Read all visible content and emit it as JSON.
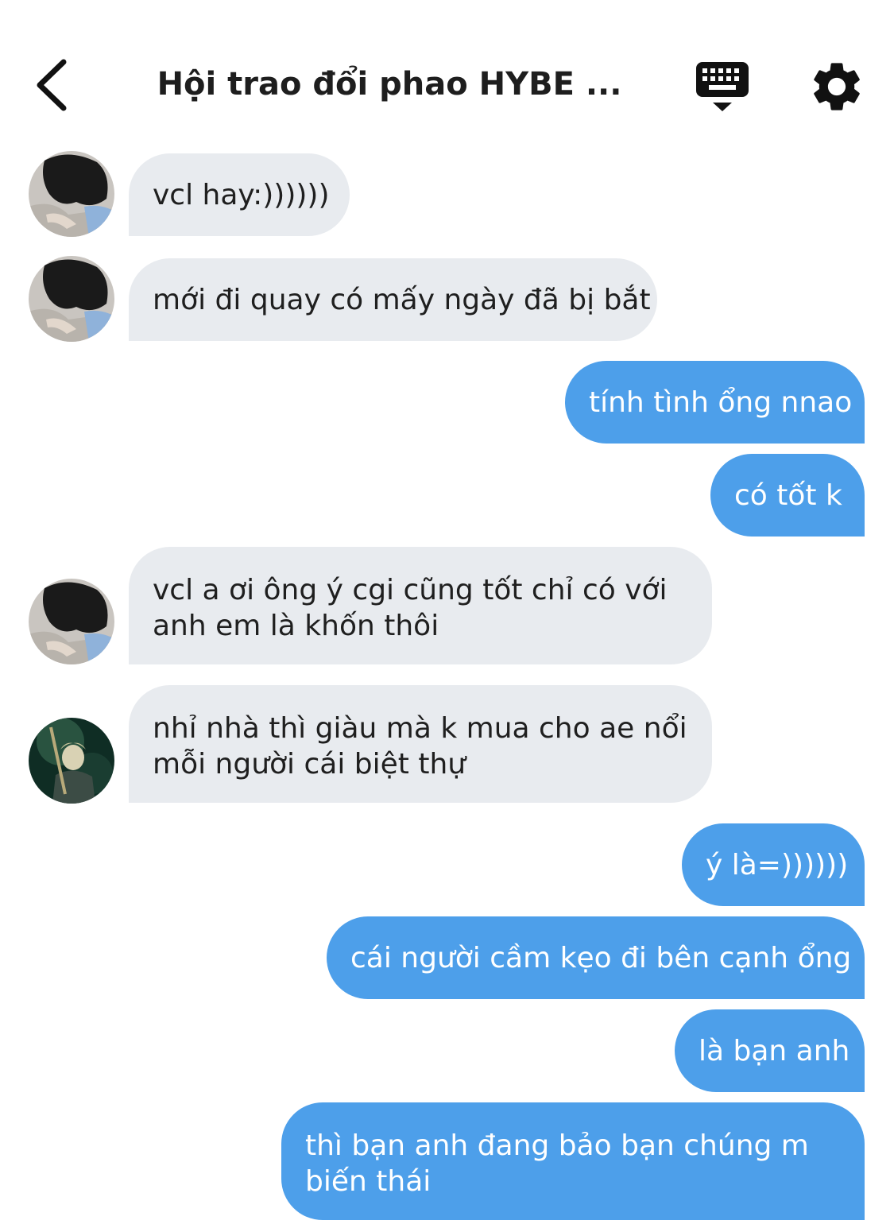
{
  "header": {
    "title": "Hội trao đổi phao HYBE ...",
    "back_icon": "chevron-left-icon",
    "keyboard_icon": "keyboard-icon",
    "settings_icon": "gear-icon"
  },
  "colors": {
    "incoming_bubble": "#e8ebef",
    "outgoing_bubble": "#4d9fea",
    "outgoing_text": "#ffffff",
    "incoming_text": "#1f1f1f"
  },
  "messages": [
    {
      "direction": "incoming",
      "sender_avatar": "avatar-a",
      "lines": [
        "vcl hay:))))))"
      ]
    },
    {
      "direction": "incoming",
      "sender_avatar": "avatar-a",
      "lines": [
        "mới đi quay có mấy ngày đã bị bắt"
      ]
    },
    {
      "direction": "outgoing",
      "lines": [
        "tính tình ổng nnao"
      ]
    },
    {
      "direction": "outgoing",
      "lines": [
        "có tốt k"
      ]
    },
    {
      "direction": "incoming",
      "sender_avatar": "avatar-a",
      "lines": [
        "vcl a ơi ông ý cgi cũng tốt chỉ có với",
        "anh em là khốn thôi"
      ]
    },
    {
      "direction": "incoming",
      "sender_avatar": "avatar-b",
      "lines": [
        "nhỉ nhà thì giàu mà k mua cho ae nổi",
        "mỗi người cái biệt thự"
      ]
    },
    {
      "direction": "outgoing",
      "lines": [
        "ý là=))))))"
      ]
    },
    {
      "direction": "outgoing",
      "lines": [
        "cái người cầm kẹo đi bên cạnh ổng"
      ]
    },
    {
      "direction": "outgoing",
      "lines": [
        "là bạn anh"
      ]
    },
    {
      "direction": "outgoing",
      "lines": [
        "thì bạn anh đang bảo bạn chúng m",
        "biến thái"
      ]
    }
  ]
}
